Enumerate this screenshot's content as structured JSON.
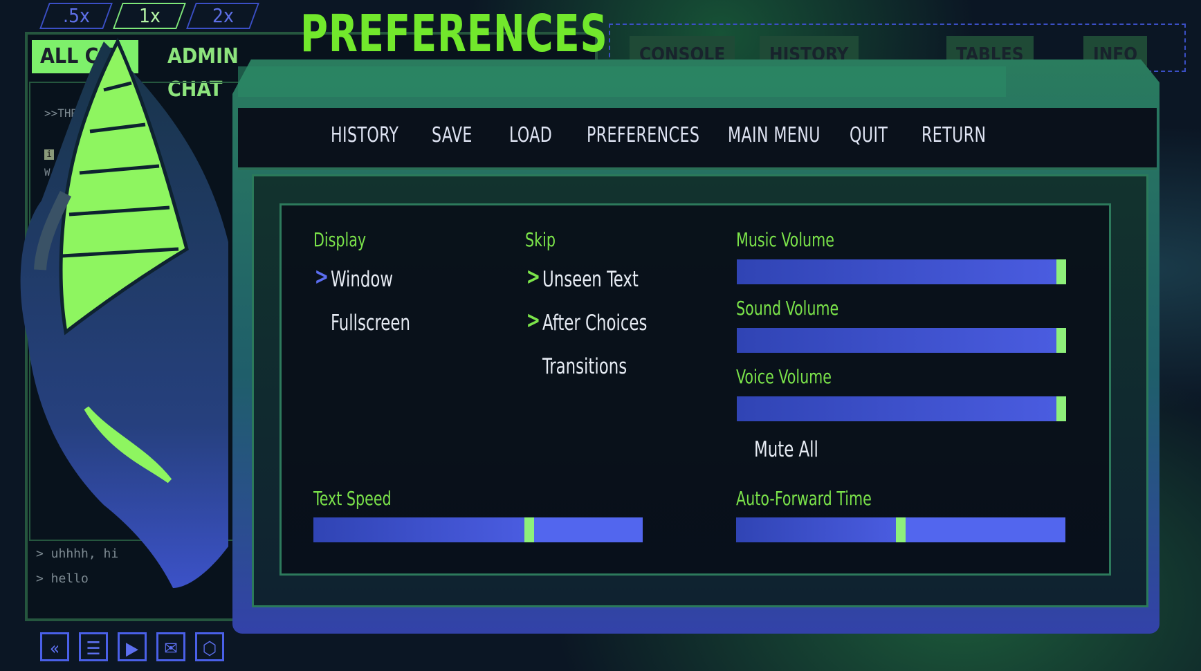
{
  "speed_buttons": [
    ".5x",
    "1x",
    "2x"
  ],
  "chat": {
    "tab_all": "ALL CH",
    "tab_admin": "ADMIN CHAT",
    "header_snippet": ">>THR",
    "info_badge": "i",
    "line_prefix": "W",
    "messages": [
      "> uhhhh, hi",
      "> hello"
    ]
  },
  "bottom_icons": [
    "rewind-icon",
    "menu-list-icon",
    "play-icon",
    "mail-icon",
    "settings-hex-icon"
  ],
  "right_window": {
    "tabs": [
      "CONSOLE",
      "HISTORY",
      "TABLES",
      "INFO"
    ]
  },
  "page_title": "PREFERENCES",
  "nav": {
    "items": [
      "HISTORY",
      "SAVE",
      "LOAD",
      "PREFERENCES",
      "MAIN MENU",
      "QUIT",
      "RETURN"
    ]
  },
  "prefs": {
    "display": {
      "label": "Display",
      "options": [
        {
          "label": "Window",
          "selected": true
        },
        {
          "label": "Fullscreen",
          "selected": false
        }
      ]
    },
    "skip": {
      "label": "Skip",
      "options": [
        {
          "label": "Unseen Text",
          "selected": true
        },
        {
          "label": "After Choices",
          "selected": true
        },
        {
          "label": "Transitions",
          "selected": false
        }
      ]
    },
    "music_volume": {
      "label": "Music Volume",
      "value": 1.0
    },
    "sound_volume": {
      "label": "Sound Volume",
      "value": 1.0
    },
    "voice_volume": {
      "label": "Voice Volume",
      "value": 1.0
    },
    "mute_all": {
      "label": "Mute All",
      "selected": false
    },
    "text_speed": {
      "label": "Text Speed",
      "value": 0.66
    },
    "auto_forward": {
      "label": "Auto-Forward Time",
      "value": 0.5
    }
  },
  "colors": {
    "accent_green": "#7be34a",
    "slider_blue": "#4d5fe6",
    "thumb_green": "#8ef07b",
    "nav_bg": "#0a111b"
  }
}
